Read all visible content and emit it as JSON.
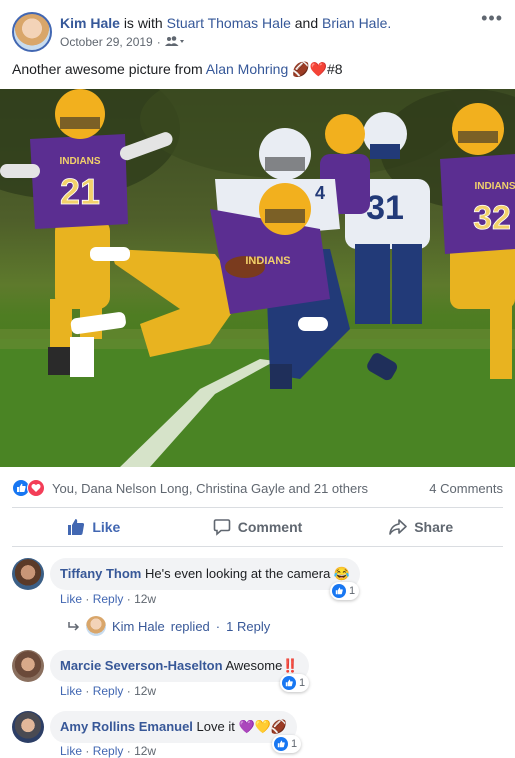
{
  "post": {
    "author": "Kim Hale",
    "with_text": "is with",
    "tagged_1": "Stuart Thomas Hale",
    "and_text": "and",
    "tagged_2": "Brian Hale.",
    "date": "October 29, 2019",
    "date_sep": "·",
    "more": "•••",
    "text_before": "Another awesome picture from",
    "text_link": "Alan Mohring",
    "text_after": "🏈❤️#8",
    "photo": {
      "jersey_numbers": [
        "21",
        "4",
        "31",
        "32"
      ],
      "jersey_text": [
        "INDIANS",
        "INDIANS",
        "INDIANS"
      ]
    }
  },
  "reactions": {
    "summary": "You, Dana Nelson Long, Christina Gayle and 21 others",
    "comments_count": "4 Comments"
  },
  "actions": {
    "like": "Like",
    "comment": "Comment",
    "share": "Share"
  },
  "comments": [
    {
      "name": "Tiffany Thom",
      "text": "He's even looking at the camera 😂",
      "like": "Like",
      "sep": "·",
      "reply": "Reply",
      "time": "12w",
      "reaction_count": "1"
    },
    {
      "name": "Marcie Severson-Haselton",
      "text": "Awesome‼️",
      "like": "Like",
      "sep": "·",
      "reply": "Reply",
      "time": "12w",
      "reaction_count": "1"
    },
    {
      "name": "Amy Rollins Emanuel",
      "text": "Love it 💜💛🏈",
      "like": "Like",
      "sep": "·",
      "reply": "Reply",
      "time": "12w",
      "reaction_count": "1"
    }
  ],
  "reply_summary": {
    "name": "Kim Hale",
    "action": "replied",
    "sep": "·",
    "count": "1 Reply"
  },
  "colors": {
    "link": "#365899",
    "like_blue": "#1877f2",
    "love_red": "#f33e58",
    "jersey_purple": "#5b2e91",
    "pants_gold": "#e8b320",
    "helmet_gold": "#f2b01e",
    "opponent_white": "#e9edf3",
    "opponent_navy": "#223a78"
  },
  "icons": [
    "friends-audience-icon",
    "like-reaction-icon",
    "love-reaction-icon",
    "thumbs-up-icon",
    "comment-icon",
    "share-icon",
    "reply-arrow-icon"
  ]
}
